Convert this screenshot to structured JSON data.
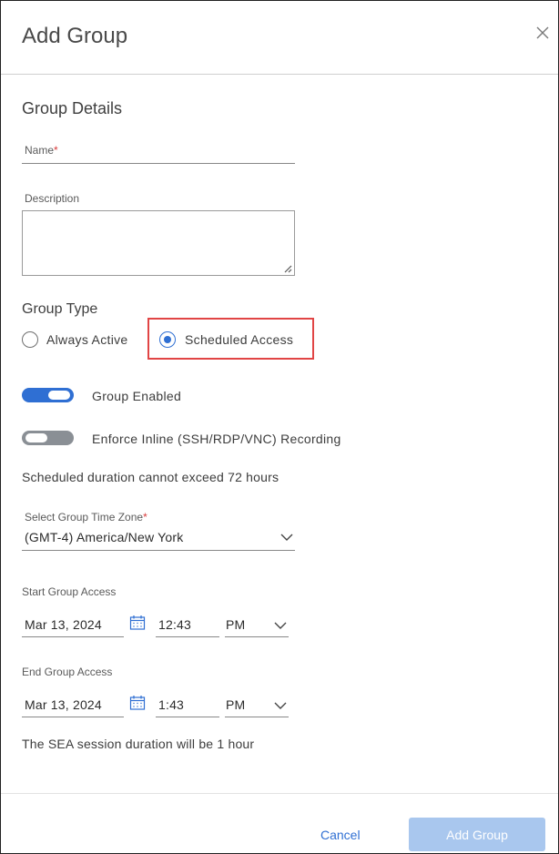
{
  "dialog": {
    "title": "Add Group"
  },
  "group_details": {
    "heading": "Group Details",
    "name_label": "Name",
    "required_marker": "*",
    "name_value": "",
    "description_label": "Description",
    "description_value": ""
  },
  "group_type": {
    "heading": "Group Type",
    "options": [
      {
        "label": "Always Active",
        "selected": false
      },
      {
        "label": "Scheduled Access",
        "selected": true
      }
    ]
  },
  "toggles": [
    {
      "label": "Group Enabled",
      "on": true
    },
    {
      "label": "Enforce Inline (SSH/RDP/VNC) Recording",
      "on": false
    }
  ],
  "schedule_note": "Scheduled duration cannot exceed 72 hours",
  "timezone": {
    "label": "Select Group Time Zone",
    "required_marker": "*",
    "value": "(GMT-4) America/New York"
  },
  "start_access": {
    "label": "Start Group Access",
    "date": "Mar 13, 2024",
    "time": "12:43",
    "ampm": "PM"
  },
  "end_access": {
    "label": "End Group Access",
    "date": "Mar 13, 2024",
    "time": "1:43",
    "ampm": "PM"
  },
  "session_note": "The SEA session duration will be 1 hour",
  "footer": {
    "cancel_label": "Cancel",
    "submit_label": "Add Group"
  },
  "colors": {
    "accent": "#2f6fd3",
    "highlight": "#e14545",
    "disabled_primary": "#a9c7ee"
  }
}
